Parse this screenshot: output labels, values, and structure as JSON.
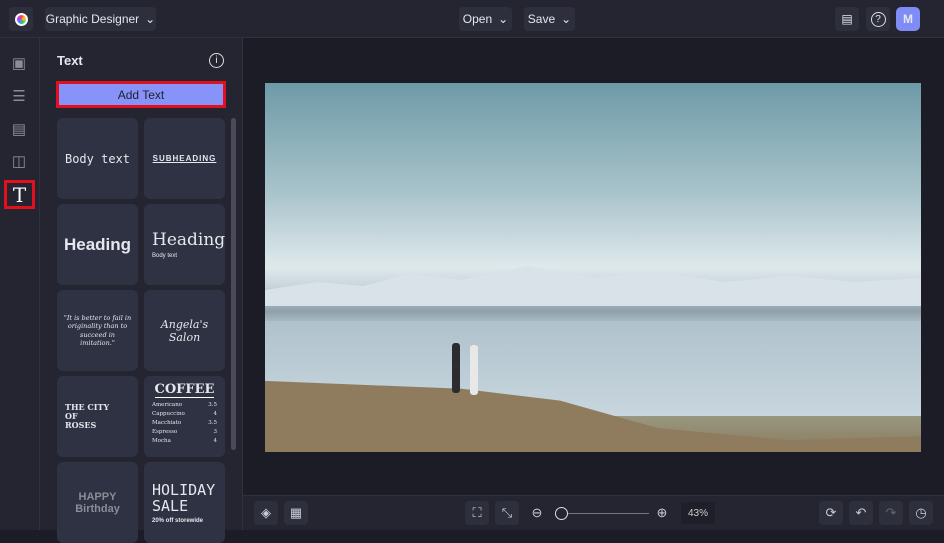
{
  "header": {
    "project": "Graphic Designer",
    "open": "Open",
    "save": "Save",
    "avatar": "M"
  },
  "panel": {
    "title": "Text",
    "add_text": "Add Text",
    "tiles": [
      "Body text",
      "SUBHEADING",
      "Heading",
      "Heading",
      "Body text",
      "\"It is better to fail in originality than to succeed in imitation.\"",
      "Angela's Salon",
      "THE CITY OF ROSES",
      "COFFEE",
      "HAPPY Birthday",
      "HOLIDAY SALE",
      "20% off storewide"
    ],
    "coffee_items": [
      [
        "Americano",
        "3.5"
      ],
      [
        "Cappuccino",
        "4"
      ],
      [
        "Macchiato",
        "3.5"
      ],
      [
        "Espresso",
        "3"
      ],
      [
        "Mocha",
        "4"
      ]
    ]
  },
  "bottom": {
    "zoom": "43%",
    "zoom_fraction": 0.05
  },
  "colors": {
    "accent": "#7f8cf5",
    "highlight": "#e0101e"
  }
}
